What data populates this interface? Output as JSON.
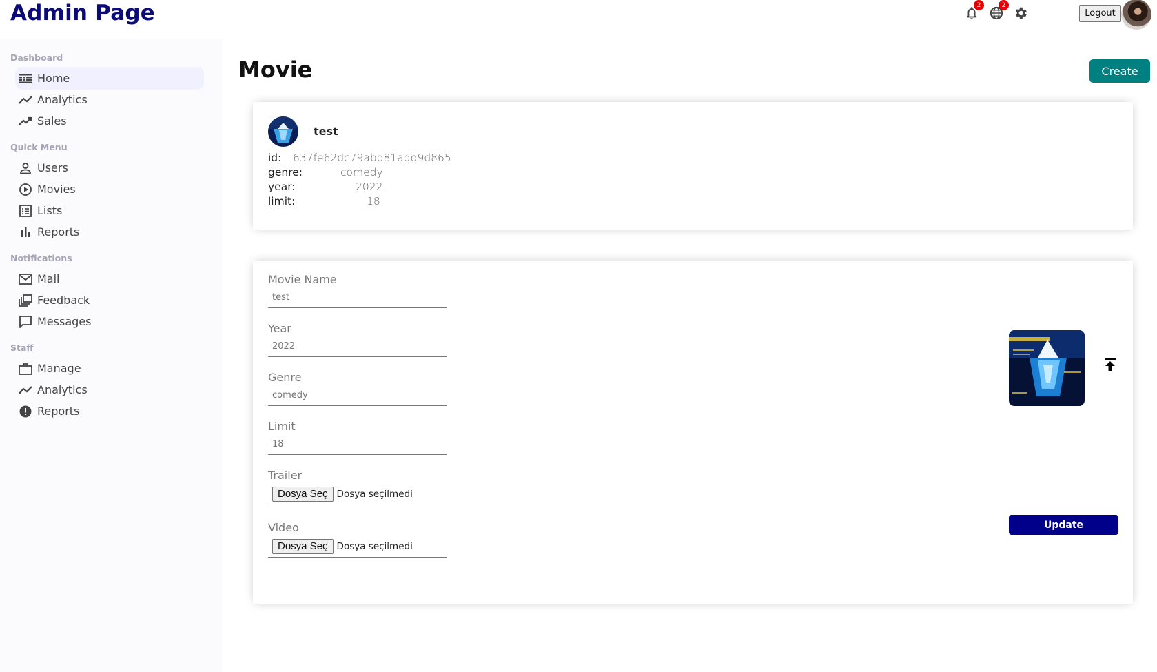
{
  "header": {
    "brand": "Admin Page",
    "notifications_count": "2",
    "language_count": "2",
    "logout_label": "Logout",
    "icons": [
      "bell-icon",
      "globe-icon",
      "gear-icon"
    ]
  },
  "sidebar": {
    "sections": [
      {
        "title": "Dashboard"
      },
      {
        "title": "Quick Menu"
      },
      {
        "title": "Notifications"
      },
      {
        "title": "Staff"
      }
    ],
    "items": [
      {
        "label": "Home",
        "icon": "home-icon"
      },
      {
        "label": "Analytics",
        "icon": "timeline-icon"
      },
      {
        "label": "Sales",
        "icon": "trending-up-icon"
      },
      {
        "label": "Users",
        "icon": "user-icon"
      },
      {
        "label": "Movies",
        "icon": "play-circle-icon"
      },
      {
        "label": "Lists",
        "icon": "list-icon"
      },
      {
        "label": "Reports",
        "icon": "bar-chart-icon"
      },
      {
        "label": "Mail",
        "icon": "mail-icon"
      },
      {
        "label": "Feedback",
        "icon": "dynamic-feed-icon"
      },
      {
        "label": "Messages",
        "icon": "chat-bubble-icon"
      },
      {
        "label": "Manage",
        "icon": "briefcase-icon"
      },
      {
        "label": "Analytics",
        "icon": "timeline-icon"
      },
      {
        "label": "Reports",
        "icon": "report-icon"
      }
    ],
    "active_item": "Home"
  },
  "main": {
    "title": "Movie",
    "create_label": "Create",
    "info": {
      "name": "test",
      "rows": [
        {
          "key": "id:",
          "value": "637fe62dc79abd81add9d865"
        },
        {
          "key": "genre:",
          "value": "comedy"
        },
        {
          "key": "year:",
          "value": "2022"
        },
        {
          "key": "limit:",
          "value": "18"
        }
      ]
    },
    "form": {
      "fields": [
        {
          "label": "Movie Name",
          "value": "test"
        },
        {
          "label": "Year",
          "value": "2022"
        },
        {
          "label": "Genre",
          "value": "comedy"
        },
        {
          "label": "Limit",
          "value": "18"
        }
      ],
      "files": [
        {
          "label": "Trailer",
          "button": "Dosya Seç",
          "status": "Dosya seçilmedi"
        },
        {
          "label": "Video",
          "button": "Dosya Seç",
          "status": "Dosya seçilmedi"
        }
      ],
      "update_label": "Update"
    }
  },
  "colors": {
    "brand": "#0a0a78",
    "create_button": "#008080",
    "update_button": "#00008b",
    "badge": "#e20000",
    "sidebar_bg": "#fbfbfe",
    "sidebar_active": "#f0f0ff"
  }
}
